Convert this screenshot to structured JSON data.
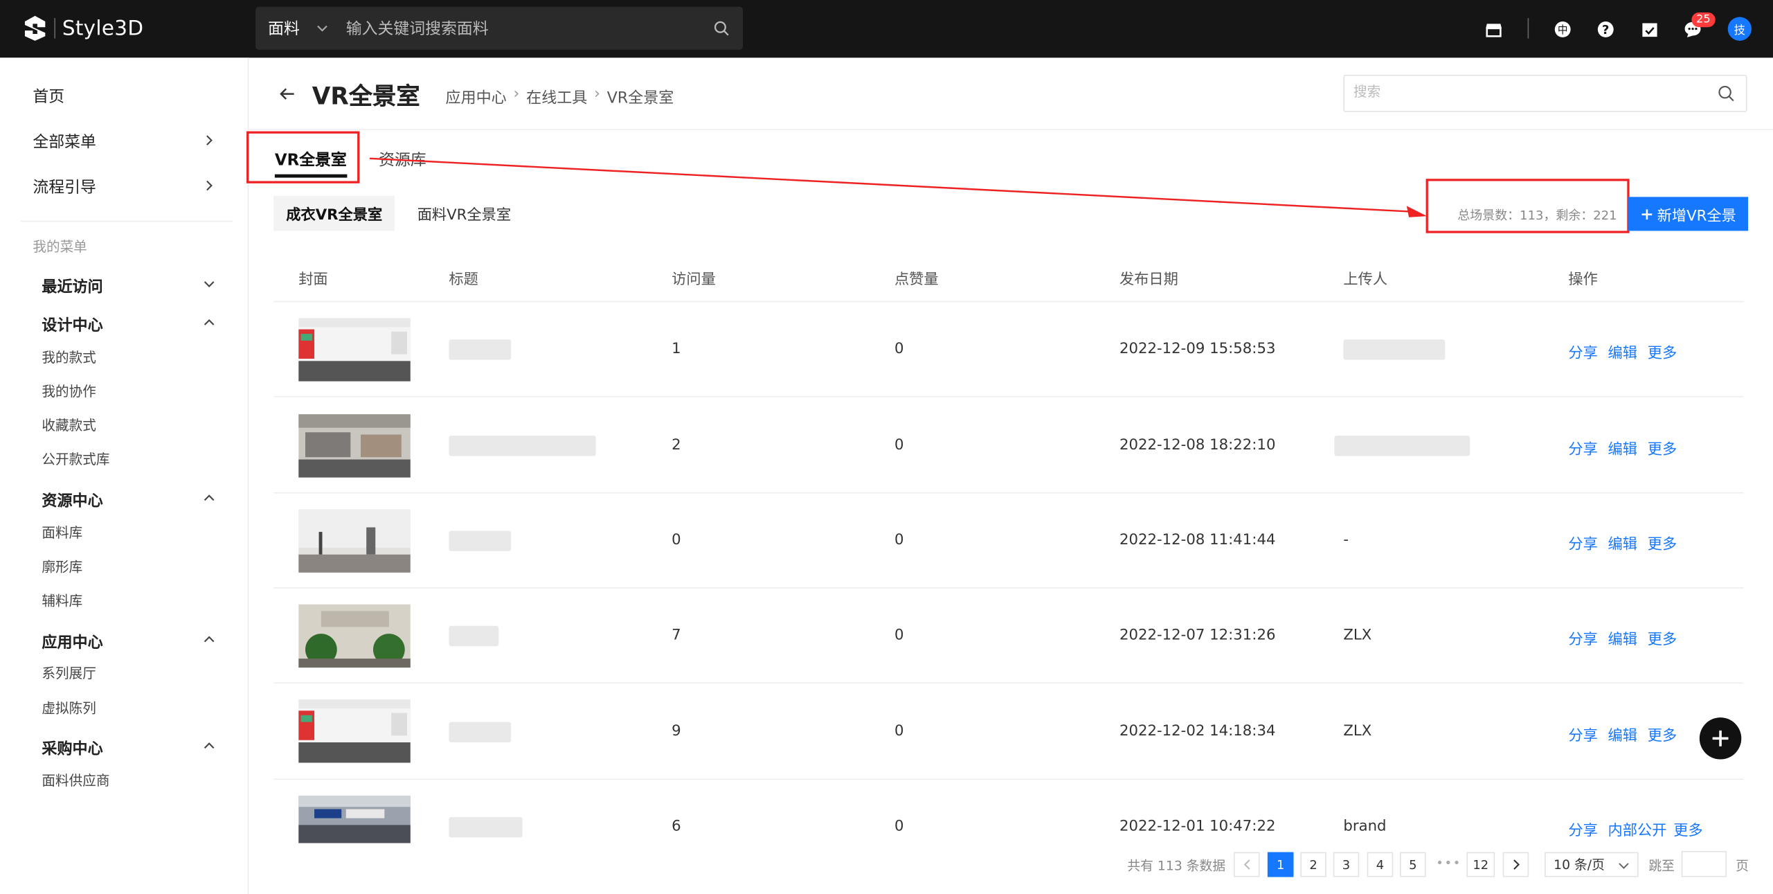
{
  "header": {
    "brand": "Style3D",
    "search_category": "面料",
    "search_placeholder": "输入关键词搜索面料",
    "notifications_count": "25",
    "avatar_text": "技"
  },
  "sidebar": {
    "main_items": [
      {
        "label": "首页"
      },
      {
        "label": "全部菜单"
      },
      {
        "label": "流程引导"
      }
    ],
    "my_menu_title": "我的菜单",
    "sections": [
      {
        "label": "最近访问",
        "items": []
      },
      {
        "label": "设计中心",
        "items": [
          "我的款式",
          "我的协作",
          "收藏款式",
          "公开款式库"
        ]
      },
      {
        "label": "资源中心",
        "items": [
          "面料库",
          "廓形库",
          "辅料库"
        ]
      },
      {
        "label": "应用中心",
        "items": [
          "系列展厅",
          "虚拟陈列"
        ]
      },
      {
        "label": "采购中心",
        "items": [
          "面料供应商"
        ]
      }
    ]
  },
  "page": {
    "title": "VR全景室",
    "breadcrumb": [
      "应用中心",
      "在线工具",
      "VR全景室"
    ],
    "search_placeholder": "搜索",
    "tabs": [
      "VR全景室",
      "资源库"
    ],
    "subtabs": [
      "成衣VR全景室",
      "面料VR全景室"
    ],
    "total_text": "总场景数：113，剩余：221",
    "new_button": "新增VR全景"
  },
  "table": {
    "headers": [
      "封面",
      "标题",
      "访问量",
      "点赞量",
      "发布日期",
      "上传人",
      "操作"
    ],
    "rows": [
      {
        "visits": "1",
        "likes": "0",
        "date": "2022-12-09 15:58:53",
        "uploader": "",
        "ops": [
          "分享",
          "编辑",
          "更多"
        ]
      },
      {
        "visits": "2",
        "likes": "0",
        "date": "2022-12-08 18:22:10",
        "uploader": "",
        "ops": [
          "分享",
          "编辑",
          "更多"
        ]
      },
      {
        "visits": "0",
        "likes": "0",
        "date": "2022-12-08 11:41:44",
        "uploader": "-",
        "ops": [
          "分享",
          "编辑",
          "更多"
        ]
      },
      {
        "visits": "7",
        "likes": "0",
        "date": "2022-12-07 12:31:26",
        "uploader": "ZLX",
        "ops": [
          "分享",
          "编辑",
          "更多"
        ]
      },
      {
        "visits": "9",
        "likes": "0",
        "date": "2022-12-02 14:18:34",
        "uploader": "ZLX",
        "ops": [
          "分享",
          "编辑",
          "更多"
        ]
      },
      {
        "visits": "6",
        "likes": "0",
        "date": "2022-12-01 10:47:22",
        "uploader": "brand",
        "ops": [
          "分享",
          "内部公开",
          "更多"
        ]
      }
    ]
  },
  "pagination": {
    "total_text": "共有 113 条数据",
    "pages": [
      "1",
      "2",
      "3",
      "4",
      "5"
    ],
    "last_page": "12",
    "current_page": "1",
    "page_size": "10 条/页",
    "jump_label": "跳至",
    "page_label": "页"
  },
  "colors": {
    "accent": "#1677ff",
    "topbar": "#151515",
    "annotation": "#ee2222"
  }
}
